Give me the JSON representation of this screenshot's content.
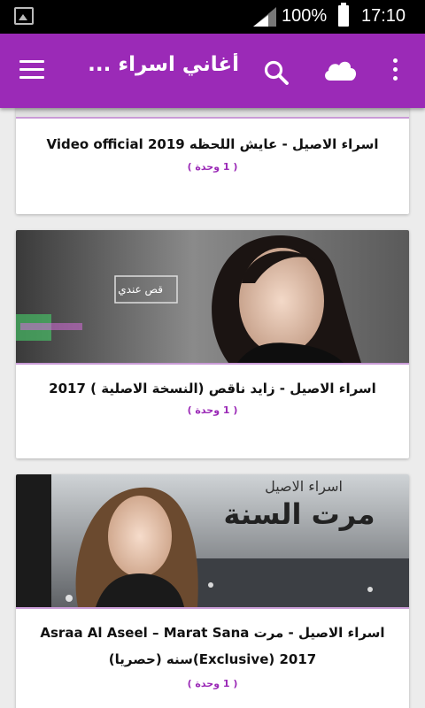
{
  "status_bar": {
    "battery": "100%",
    "time": "17:10"
  },
  "app_bar": {
    "title": "أغاني اسراء ...",
    "icons": [
      "menu-icon",
      "search-icon",
      "cloud-icon",
      "more-vert-icon"
    ],
    "color": "#9b2ab7"
  },
  "cards": [
    {
      "title": "اسراء الاصيل - عايش اللحظه  Video official 2019",
      "count": "( 1 وحدة )"
    },
    {
      "title": "اسراء الاصيل - زايد ناقص (النسخة الاصلية )  2017",
      "count": "( 1 وحدة )",
      "thumb_text": "قص عندي"
    },
    {
      "title": "اسراء الاصيل - مرت  Asraa Al Aseel – Marat Sana (Exclusive) 2017سنه (حصريا)",
      "count": "( 1 وحدة )",
      "thumb_text": "مرت السنة",
      "thumb_text2": "اسراء الاصيل"
    }
  ]
}
